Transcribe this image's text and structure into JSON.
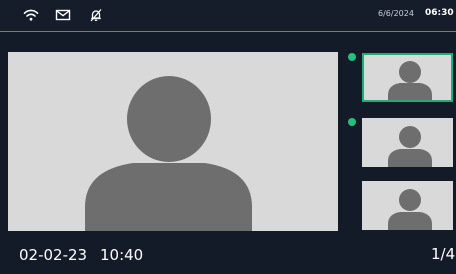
{
  "status_bar": {
    "icons": [
      "wifi-icon",
      "mail-icon",
      "notifications-off-icon"
    ],
    "date": "6/6/2024",
    "time": "06:30",
    "accent_color": "#1fae77"
  },
  "main_view": {
    "placeholder_icon": "person-silhouette-icon"
  },
  "thumbnails": [
    {
      "selected": true,
      "online": true,
      "icon": "person-silhouette-icon"
    },
    {
      "selected": false,
      "online": true,
      "icon": "person-silhouette-icon"
    },
    {
      "selected": false,
      "online": false,
      "icon": "person-silhouette-icon"
    }
  ],
  "footer": {
    "date": "02-02-23",
    "time": "10:40",
    "page_indicator": "1/4"
  }
}
